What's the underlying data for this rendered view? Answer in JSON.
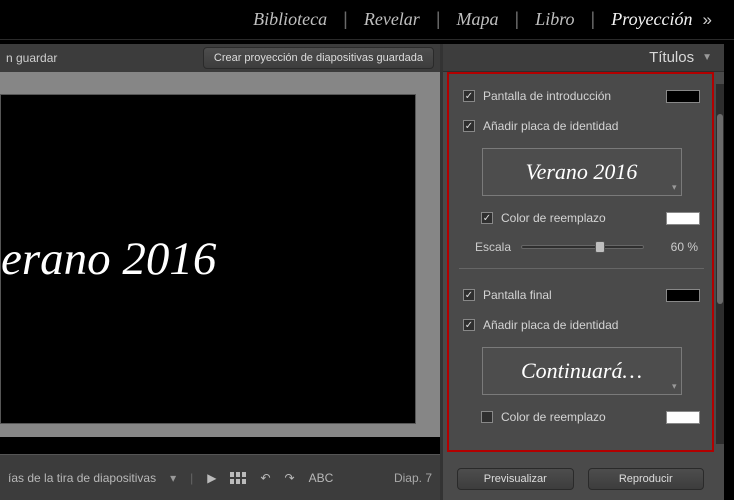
{
  "nav": {
    "biblioteca": "Biblioteca",
    "revelar": "Revelar",
    "mapa": "Mapa",
    "libro": "Libro",
    "proyeccion": "Proyección"
  },
  "toolbar": {
    "fragment": "n guardar",
    "create_saved": "Crear proyección de diapositivas guardada"
  },
  "preview": {
    "title_text": "erano 2016"
  },
  "bottom": {
    "filmstrip_label": "ías de la tira de diapositivas",
    "abc": "ABC",
    "diap": "Diap. 7"
  },
  "panel": {
    "header": "Títulos",
    "intro_screen": "Pantalla de introducción",
    "add_identity_plate": "Añadir placa de identidad",
    "plate1_text": "Verano 2016",
    "override_color": "Color de reemplazo",
    "scale_label": "Escala",
    "scale_value": "60 %",
    "end_screen": "Pantalla final",
    "plate2_text": "Continuará…",
    "preview_btn": "Previsualizar",
    "play_btn": "Reproducir"
  },
  "colors": {
    "intro_swatch": "#000000",
    "end_swatch": "#000000",
    "override_swatch": "#ffffff"
  },
  "slider": {
    "scale_pct": 60
  }
}
